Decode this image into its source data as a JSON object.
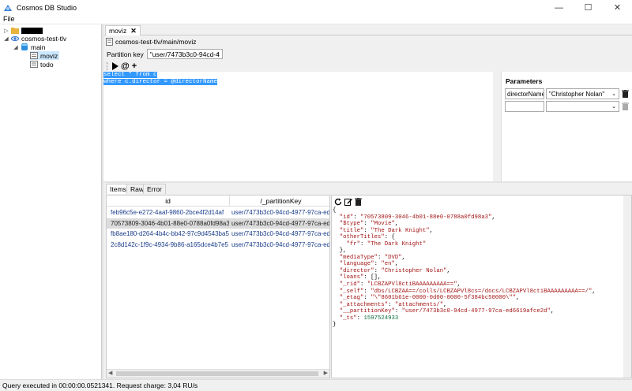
{
  "window": {
    "title": "Cosmos DB Studio",
    "controls": [
      "minimize",
      "maximize",
      "close"
    ]
  },
  "menu": {
    "file_label": "File"
  },
  "tree": {
    "account_label": "",
    "connection_label": "cosmos-test-tlv",
    "database_label": "main",
    "collections": [
      {
        "label": "moviz",
        "selected": true
      },
      {
        "label": "todo",
        "selected": false
      }
    ]
  },
  "document_tab": {
    "label": "moviz",
    "close_glyph": "✕"
  },
  "path": {
    "text": "cosmos-test-tlv/main/moviz"
  },
  "partition_key": {
    "label": "Partition key",
    "value": "\"user/7473b3c0-94cd-4"
  },
  "query": {
    "lines": [
      "select * from c",
      "where c.director = @directorName"
    ]
  },
  "parameters": {
    "title": "Parameters",
    "rows": [
      {
        "name": "directorName",
        "value": "\"Christopher Nolan\""
      },
      {
        "name": "",
        "value": ""
      }
    ]
  },
  "result_tabs": [
    {
      "label": "Items",
      "active": true
    },
    {
      "label": "Raw",
      "active": false
    },
    {
      "label": "Error",
      "active": false
    }
  ],
  "grid": {
    "columns": [
      "id",
      "/_partitionKey"
    ],
    "rows": [
      {
        "id": "feb96c5e-e272-4aaf-9860-2bce4f2d14af",
        "pk": "user/7473b3c0-94cd-4977-97ca-ed6",
        "selected": false
      },
      {
        "id": "70573809-3046-4b01-88e0-0788a0fd98a3",
        "pk": "user/7473b3c0-94cd-4977-97ca-ed6",
        "selected": true
      },
      {
        "id": "fb8ae180-d264-4b4c-bb42-97c9d4543ba5",
        "pk": "user/7473b3c0-94cd-4977-97ca-ed6",
        "selected": false
      },
      {
        "id": "2c8d142c-1f9c-4934-9b86-a165dce4b7e5",
        "pk": "user/7473b3c0-94cd-4977-97ca-ed6",
        "selected": false
      }
    ]
  },
  "json_lines": [
    [
      {
        "t": "p",
        "s": "{"
      }
    ],
    [
      {
        "t": "p",
        "s": "  "
      },
      {
        "t": "k",
        "s": "\"id\""
      },
      {
        "t": "p",
        "s": ": "
      },
      {
        "t": "v",
        "s": "\"70573809-3046-4b01-88e0-0788a0fd98a3\""
      },
      {
        "t": "p",
        "s": ","
      }
    ],
    [
      {
        "t": "p",
        "s": "  "
      },
      {
        "t": "k",
        "s": "\"$type\""
      },
      {
        "t": "p",
        "s": ": "
      },
      {
        "t": "v",
        "s": "\"Movie\""
      },
      {
        "t": "p",
        "s": ","
      }
    ],
    [
      {
        "t": "p",
        "s": "  "
      },
      {
        "t": "k",
        "s": "\"title\""
      },
      {
        "t": "p",
        "s": ": "
      },
      {
        "t": "v",
        "s": "\"The Dark Knight\""
      },
      {
        "t": "p",
        "s": ","
      }
    ],
    [
      {
        "t": "p",
        "s": "  "
      },
      {
        "t": "k",
        "s": "\"otherTitles\""
      },
      {
        "t": "p",
        "s": ": {"
      }
    ],
    [
      {
        "t": "p",
        "s": "    "
      },
      {
        "t": "k",
        "s": "\"fr\""
      },
      {
        "t": "p",
        "s": ": "
      },
      {
        "t": "v",
        "s": "\"The Dark Knight\""
      }
    ],
    [
      {
        "t": "p",
        "s": "  },"
      }
    ],
    [
      {
        "t": "p",
        "s": "  "
      },
      {
        "t": "k",
        "s": "\"mediaType\""
      },
      {
        "t": "p",
        "s": ": "
      },
      {
        "t": "v",
        "s": "\"DVD\""
      },
      {
        "t": "p",
        "s": ","
      }
    ],
    [
      {
        "t": "p",
        "s": "  "
      },
      {
        "t": "k",
        "s": "\"language\""
      },
      {
        "t": "p",
        "s": ": "
      },
      {
        "t": "v",
        "s": "\"en\""
      },
      {
        "t": "p",
        "s": ","
      }
    ],
    [
      {
        "t": "p",
        "s": "  "
      },
      {
        "t": "k",
        "s": "\"director\""
      },
      {
        "t": "p",
        "s": ": "
      },
      {
        "t": "v",
        "s": "\"Christopher Nolan\""
      },
      {
        "t": "p",
        "s": ","
      }
    ],
    [
      {
        "t": "p",
        "s": "  "
      },
      {
        "t": "k",
        "s": "\"loans\""
      },
      {
        "t": "p",
        "s": ": [],"
      }
    ],
    [
      {
        "t": "p",
        "s": "  "
      },
      {
        "t": "k",
        "s": "\"_rid\""
      },
      {
        "t": "p",
        "s": ": "
      },
      {
        "t": "v",
        "s": "\"LCBZAPVl8ctiBAAAAAAAAA==\""
      },
      {
        "t": "p",
        "s": ","
      }
    ],
    [
      {
        "t": "p",
        "s": "  "
      },
      {
        "t": "k",
        "s": "\"_self\""
      },
      {
        "t": "p",
        "s": ": "
      },
      {
        "t": "v",
        "s": "\"dbs/LCBZAA==/colls/LCBZAPVl8cs=/docs/LCBZAPVl8ctiBAAAAAAAAA==/\""
      },
      {
        "t": "p",
        "s": ","
      }
    ],
    [
      {
        "t": "p",
        "s": "  "
      },
      {
        "t": "k",
        "s": "\"_etag\""
      },
      {
        "t": "p",
        "s": ": "
      },
      {
        "t": "v",
        "s": "\"\\\"8601b61e-0000-0d00-0000-5f384bc50000\\\"\""
      },
      {
        "t": "p",
        "s": ","
      }
    ],
    [
      {
        "t": "p",
        "s": "  "
      },
      {
        "t": "k",
        "s": "\"_attachments\""
      },
      {
        "t": "p",
        "s": ": "
      },
      {
        "t": "v",
        "s": "\"attachments/\""
      },
      {
        "t": "p",
        "s": ","
      }
    ],
    [
      {
        "t": "p",
        "s": "  "
      },
      {
        "t": "k",
        "s": "\"__partitionKey\""
      },
      {
        "t": "p",
        "s": ": "
      },
      {
        "t": "v",
        "s": "\"user/7473b3c0-94cd-4977-97ca-ed6619afce2d\""
      },
      {
        "t": "p",
        "s": ","
      }
    ],
    [
      {
        "t": "p",
        "s": "  "
      },
      {
        "t": "k",
        "s": "\"_ts\""
      },
      {
        "t": "p",
        "s": ": "
      },
      {
        "t": "n",
        "s": "1597524933"
      }
    ],
    [
      {
        "t": "p",
        "s": "}"
      }
    ]
  ],
  "status": {
    "text": "Query executed in 00:00:00.0521341. Request charge: 3,04 RU/s"
  },
  "colors": {
    "selection": "#3399ff",
    "tree_selected": "#cce8ff",
    "json_key": "#a31515",
    "json_number": "#0b6c3c",
    "grid_link": "#1a3d8a"
  }
}
